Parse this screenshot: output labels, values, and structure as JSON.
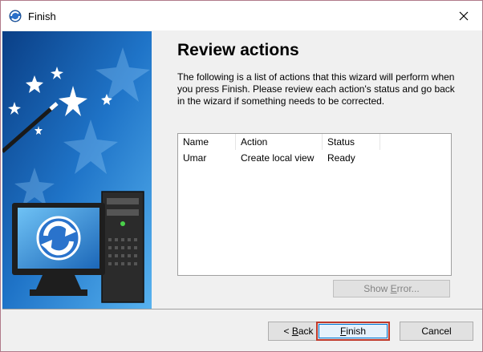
{
  "window": {
    "title": "Finish"
  },
  "page": {
    "heading": "Review actions",
    "description": "The following is a list of actions that this wizard will perform when you press Finish. Please review each action's status and go back in the wizard if something needs to be corrected."
  },
  "actions_table": {
    "columns": [
      "Name",
      "Action",
      "Status"
    ],
    "rows": [
      {
        "name": "Umar",
        "action": "Create local view",
        "status": "Ready"
      }
    ]
  },
  "buttons": {
    "show_error": {
      "pre": "Show ",
      "key": "E",
      "post": "rror..."
    },
    "back": {
      "pre": "< ",
      "key": "B",
      "post": "ack"
    },
    "finish": {
      "key": "F",
      "post": "inish"
    },
    "cancel": "Cancel"
  },
  "colors": {
    "banner_dark": "#0a4a8f",
    "banner_light": "#3d9ae0",
    "finish_highlight": "#c0392b"
  },
  "icons": [
    "app-icon",
    "close-icon",
    "magic-wand-icon",
    "computer-sync-icon"
  ]
}
